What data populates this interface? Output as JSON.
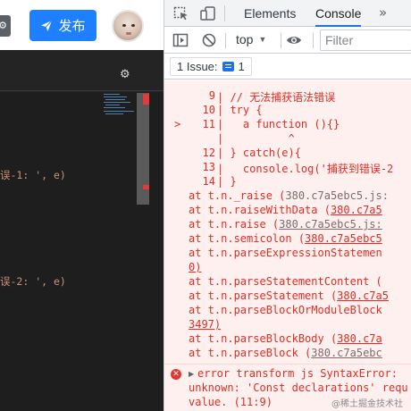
{
  "page": {
    "publish_button_label": "发布",
    "watermark_text": "@稀土掘金技术社区"
  },
  "editor": {
    "line1": {
      "prefix": "误-1: ', e)"
    },
    "line2": {
      "prefix": "误-2: ', e)"
    }
  },
  "devtools": {
    "tabs": [
      {
        "label": "Elements"
      },
      {
        "label": "Console"
      }
    ],
    "more_tabs_glyph": "»",
    "context_select": "top",
    "filter_placeholder": "Filter",
    "issues_label": "1 Issue:",
    "issues_count": "1"
  },
  "console": {
    "frame": [
      {
        "num": "9",
        "code": " // 无法捕获语法错误"
      },
      {
        "num": "10",
        "code": " try {"
      },
      {
        "marker": ">",
        "num": "11",
        "code": "   a function (){}"
      },
      {
        "num": "",
        "code": "          ^"
      },
      {
        "num": "12",
        "code": " } catch(e){"
      },
      {
        "num": "13",
        "code": "   console.log('捕获到错误-2"
      },
      {
        "num": "14",
        "code": " }"
      }
    ],
    "stack": [
      {
        "text": "at t.n._raise (",
        "link": "380.c7a5ebc5.js:",
        "linked": false
      },
      {
        "text": "at t.n.raiseWithData (",
        "link": "380.c7a5",
        "linked": true
      },
      {
        "text": "at t.n.raise (",
        "link": "380.c7a5ebc5.js:",
        "linked": true
      },
      {
        "text": "at t.n.semicolon (",
        "link": "380.c7a5ebc5",
        "linked": true
      },
      {
        "text": "at t.n.parseExpressionStatemen",
        "link": "",
        "linked": false
      },
      {
        "text": "at t.n.parseStatementContent (",
        "link": "",
        "linked": false
      },
      {
        "text": "at t.n.parseStatement (",
        "link": "380.c7a5",
        "linked": true
      },
      {
        "text": "at t.n.parseBlockOrModuleBlock",
        "link": "",
        "linked": false
      },
      {
        "text": "at t.n.parseBlockBody (",
        "link": "380.c7a",
        "linked": true
      },
      {
        "text": "at t.n.parseBlock (",
        "link": "380.c7a5ebc",
        "linked": true
      }
    ],
    "cont_0": "0)",
    "cont_3497": "3497)",
    "error_line1": "error transform js SyntaxError:",
    "error_line2": "unknown: 'Const declarations' requ",
    "error_line3": "value. (11:9)"
  }
}
